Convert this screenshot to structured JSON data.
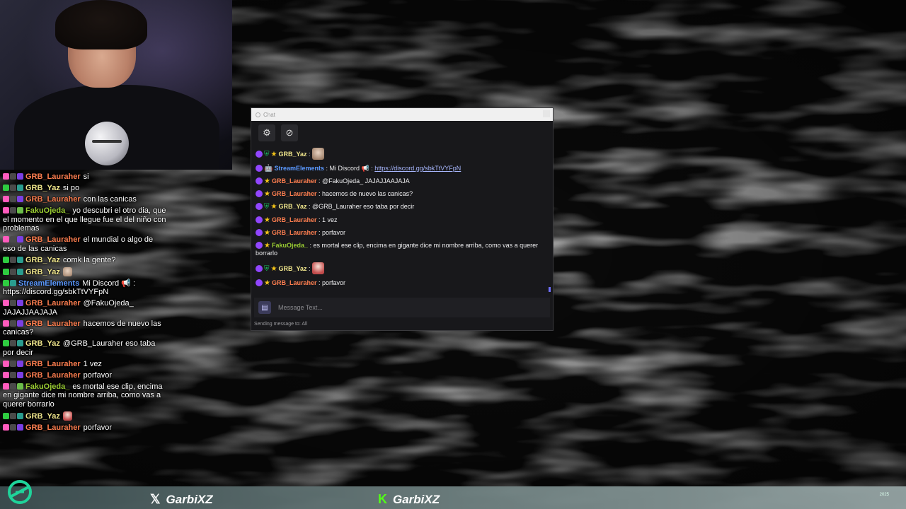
{
  "overlay_chat": [
    {
      "name": "GRB_Lauraher",
      "color": "#ff7f50",
      "badges": [
        "#ff5bbd",
        "#4a4a4a",
        "#7b3fe4"
      ],
      "text": "si"
    },
    {
      "name": "GRB_Yaz",
      "color": "#f0e68c",
      "badges": [
        "#2ecc40",
        "#4a4a4a",
        "#2a9d8f"
      ],
      "text": "si po"
    },
    {
      "name": "GRB_Lauraher",
      "color": "#ff7f50",
      "badges": [
        "#ff5bbd",
        "#4a4a4a",
        "#7b3fe4"
      ],
      "text": "con las canicas"
    },
    {
      "name": "FakuOjeda_",
      "color": "#9acd32",
      "badges": [
        "#ff5bbd",
        "#4a4a4a",
        "#6bbd4a"
      ],
      "text": "yo descubri el otro dia, que el momento en el que llegue fue el del niño con problemas"
    },
    {
      "name": "GRB_Lauraher",
      "color": "#ff7f50",
      "badges": [
        "#ff5bbd",
        "#4a4a4a",
        "#7b3fe4"
      ],
      "text": "el mundial o algo de eso de las canicas"
    },
    {
      "name": "GRB_Yaz",
      "color": "#f0e68c",
      "badges": [
        "#2ecc40",
        "#4a4a4a",
        "#2a9d8f"
      ],
      "text": "comk la gente?"
    },
    {
      "name": "GRB_Yaz",
      "color": "#f0e68c",
      "badges": [
        "#2ecc40",
        "#4a4a4a",
        "#2a9d8f"
      ],
      "text": "",
      "emote": "face"
    },
    {
      "name": "StreamElements",
      "color": "#5b99ff",
      "badges": [
        "#2ecc40",
        "#2a9d8f"
      ],
      "text": "Mi Discord 📢 : https://discord.gg/sbkTtVYFpN"
    },
    {
      "name": "GRB_Lauraher",
      "color": "#ff7f50",
      "badges": [
        "#ff5bbd",
        "#4a4a4a",
        "#7b3fe4"
      ],
      "text": "@FakuOjeda_ JAJAJJAAJAJA"
    },
    {
      "name": "GRB_Lauraher",
      "color": "#ff7f50",
      "badges": [
        "#ff5bbd",
        "#4a4a4a",
        "#7b3fe4"
      ],
      "text": "hacemos de nuevo las canicas?"
    },
    {
      "name": "GRB_Yaz",
      "color": "#f0e68c",
      "badges": [
        "#2ecc40",
        "#4a4a4a",
        "#2a9d8f"
      ],
      "text": "@GRB_Lauraher eso taba por decir"
    },
    {
      "name": "GRB_Lauraher",
      "color": "#ff7f50",
      "badges": [
        "#ff5bbd",
        "#4a4a4a",
        "#7b3fe4"
      ],
      "text": "1 vez"
    },
    {
      "name": "GRB_Lauraher",
      "color": "#ff7f50",
      "badges": [
        "#ff5bbd",
        "#4a4a4a",
        "#7b3fe4"
      ],
      "text": "porfavor"
    },
    {
      "name": "FakuOjeda_",
      "color": "#9acd32",
      "badges": [
        "#ff5bbd",
        "#4a4a4a",
        "#6bbd4a"
      ],
      "text": "es mortal ese clip, encima en gigante dice mi nombre arriba, como vas a querer borrarlo"
    },
    {
      "name": "GRB_Yaz",
      "color": "#f0e68c",
      "badges": [
        "#2ecc40",
        "#4a4a4a",
        "#2a9d8f"
      ],
      "text": "",
      "emote": "girl"
    },
    {
      "name": "GRB_Lauraher",
      "color": "#ff7f50",
      "badges": [
        "#ff5bbd",
        "#4a4a4a",
        "#7b3fe4"
      ],
      "text": "porfavor"
    }
  ],
  "chat_window": {
    "title": "Chat",
    "toolbar": {
      "settings_icon": "gear-icon",
      "mod_icon": "compass-icon"
    },
    "messages": [
      {
        "name": "GRB_Yaz",
        "color": "#f0e68c",
        "badges": [
          "twitch",
          "shield",
          "star"
        ],
        "text": "",
        "emote": "face"
      },
      {
        "name": "StreamElements",
        "color": "#5b99ff",
        "badges": [
          "twitch",
          "bot"
        ],
        "text": "Mi Discord 📢 : ",
        "link": "https://discord.gg/sbkTtVYFpN"
      },
      {
        "name": "GRB_Lauraher",
        "color": "#ff7f50",
        "badges": [
          "twitch",
          "star"
        ],
        "text": "@FakuOjeda_ JAJAJJAAJAJA"
      },
      {
        "name": "GRB_Lauraher",
        "color": "#ff7f50",
        "badges": [
          "twitch",
          "star"
        ],
        "text": "hacemos de nuevo las canicas?"
      },
      {
        "name": "GRB_Yaz",
        "color": "#f0e68c",
        "badges": [
          "twitch",
          "shield",
          "star"
        ],
        "text": "@GRB_Lauraher eso taba por decir"
      },
      {
        "name": "GRB_Lauraher",
        "color": "#ff7f50",
        "badges": [
          "twitch",
          "star"
        ],
        "text": "1 vez"
      },
      {
        "name": "GRB_Lauraher",
        "color": "#ff7f50",
        "badges": [
          "twitch",
          "star"
        ],
        "text": "porfavor"
      },
      {
        "name": "FakuOjeda_",
        "color": "#9acd32",
        "badges": [
          "twitch",
          "star"
        ],
        "text": "es mortal ese clip, encima en gigante dice mi nombre arriba, como vas a querer borrarlo"
      },
      {
        "name": "GRB_Yaz",
        "color": "#f0e68c",
        "badges": [
          "twitch",
          "shield",
          "star"
        ],
        "text": "",
        "emote": "girl"
      },
      {
        "name": "GRB_Lauraher",
        "color": "#ff7f50",
        "badges": [
          "twitch",
          "star"
        ],
        "text": "porfavor"
      }
    ],
    "input_placeholder": "Message Text...",
    "sending_to": "Sending message to: All"
  },
  "bottom_bar": {
    "twitter_handle": "GarbiXZ",
    "kick_handle": "GarbiXZ",
    "clock": "2025"
  }
}
